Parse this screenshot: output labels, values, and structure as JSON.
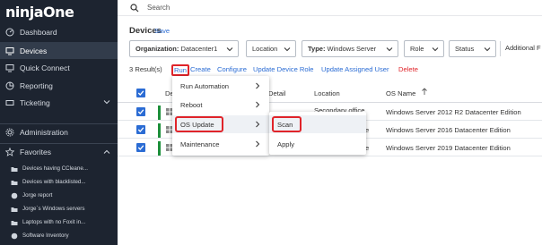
{
  "brand": {
    "logo": "ninjaOne"
  },
  "sidebar": {
    "items": [
      {
        "label": "Dashboard",
        "icon": "dashboard-icon"
      },
      {
        "label": "Devices",
        "icon": "monitor-icon",
        "active": true
      },
      {
        "label": "Quick Connect",
        "icon": "monitor-icon"
      },
      {
        "label": "Reporting",
        "icon": "chart-icon"
      },
      {
        "label": "Ticketing",
        "icon": "ticket-icon"
      },
      {
        "label": "Administration",
        "icon": "gear-icon"
      },
      {
        "label": "Favorites",
        "icon": "star-icon"
      }
    ],
    "favorites": [
      "Devices having CCleane...",
      "Devices with blacklisted...",
      "Jorge report",
      "Jorge´s Windows servers",
      "Laptops with no Foxit in...",
      "Software Inventory"
    ]
  },
  "search": {
    "placeholder": "Search"
  },
  "page": {
    "title": "Devices",
    "save_label": "Save"
  },
  "filters": {
    "organization_label": "Organization:",
    "organization_value": "Datacenter1",
    "location": "Location",
    "type_label": "Type:",
    "type_value": "Windows Server",
    "role": "Role",
    "status": "Status",
    "additional": "Additional F"
  },
  "toolbar": {
    "count": "3 Result(s)",
    "run": "Run",
    "create": "Create",
    "configure": "Configure",
    "update_role": "Update Device Role",
    "update_user": "Update Assigned User",
    "delete": "Delete"
  },
  "table": {
    "headers": {
      "device": "De",
      "detail": "Detail",
      "location": "Location",
      "os": "OS Name"
    },
    "rows": [
      {
        "location": "Secondary office",
        "os": "Windows Server 2012 R2 Datacenter Edition"
      },
      {
        "location": "e",
        "os": "Windows Server 2016 Datacenter Edition"
      },
      {
        "location": "e",
        "os": "Windows Server 2019 Datacenter Edition"
      }
    ]
  },
  "run_menu": {
    "items": [
      {
        "label": "Run Automation"
      },
      {
        "label": "Reboot"
      },
      {
        "label": "OS Update"
      },
      {
        "label": "Maintenance"
      }
    ],
    "submenu": [
      {
        "label": "Scan"
      },
      {
        "label": "Apply"
      }
    ]
  },
  "colors": {
    "sidebar_bg": "#1d2430",
    "accent": "#2b6cd4",
    "highlight": "#e0242a",
    "status_green": "#1c8f3a"
  }
}
